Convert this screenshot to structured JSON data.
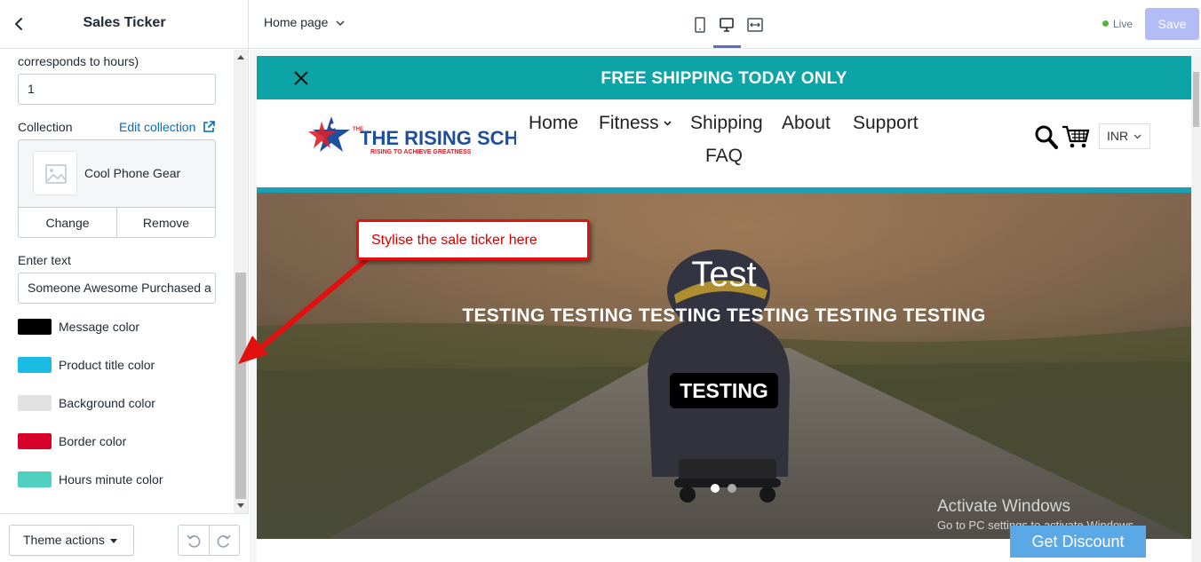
{
  "panel": {
    "title": "Sales Ticker",
    "hours_label_tail": "corresponds to hours)",
    "hours_value": "1",
    "collection_label": "Collection",
    "edit_collection": "Edit collection",
    "collection_name": "Cool Phone Gear",
    "change_label": "Change",
    "remove_label": "Remove",
    "enter_text_label": "Enter text",
    "enter_text_value": "Someone Awesome Purchased a",
    "colors": [
      {
        "label": "Message color",
        "hex": "#000000"
      },
      {
        "label": "Product title color",
        "hex": "#1bbce3"
      },
      {
        "label": "Background color",
        "hex": "#e2e2e2"
      },
      {
        "label": "Border color",
        "hex": "#d6022c"
      },
      {
        "label": "Hours minute color",
        "hex": "#4fd0c0"
      }
    ],
    "theme_actions": "Theme actions"
  },
  "topbar": {
    "page_select": "Home page",
    "devices": [
      "mobile-icon",
      "desktop-icon",
      "fullscreen-icon"
    ],
    "active_device": "desktop-icon",
    "status": "Live",
    "save_label": "Save"
  },
  "preview": {
    "announcement": "FREE SHIPPING TODAY ONLY",
    "logo_text": "THE RISING SCHOOL",
    "logo_tagline": "RISING TO ACHIEVE GREATNESS",
    "nav": [
      "Home",
      "Fitness",
      "Shipping",
      "About",
      "Support",
      "FAQ"
    ],
    "currency": "INR",
    "hero_title": "Test",
    "hero_subtitle": "TESTING TESTING TESTING TESTING TESTING TESTING",
    "hero_button": "TESTING",
    "slides": 2,
    "active_slide": 1,
    "get_discount": "Get Discount"
  },
  "annotation": {
    "text": "Stylise the sale ticker here"
  },
  "watermark": {
    "line1": "Activate Windows",
    "line2": "Go to PC settings to activate Windows."
  },
  "colors": {
    "announcement_bg": "#0ca4a6",
    "save_disabled": "#b3bcf5",
    "link": "#006fbb",
    "annotation_red": "#e31010",
    "discount_btn": "#5aa9e6"
  }
}
